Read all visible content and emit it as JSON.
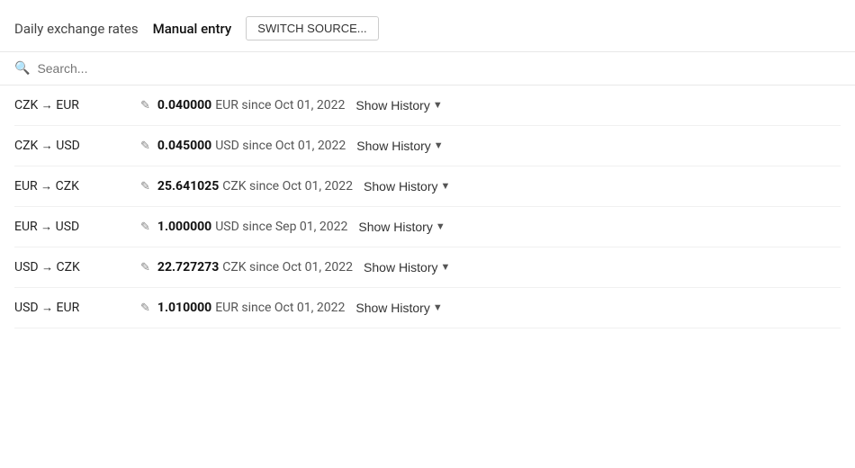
{
  "header": {
    "title": "Daily exchange rates",
    "tab_active": "Manual entry",
    "switch_btn": "SWITCH SOURCE..."
  },
  "search": {
    "placeholder": "Search..."
  },
  "rates": [
    {
      "pair_from": "CZK",
      "pair_to": "EUR",
      "value": "0.040000",
      "currency": "EUR",
      "since": "since Oct 01, 2022",
      "show_history": "Show History"
    },
    {
      "pair_from": "CZK",
      "pair_to": "USD",
      "value": "0.045000",
      "currency": "USD",
      "since": "since Oct 01, 2022",
      "show_history": "Show History"
    },
    {
      "pair_from": "EUR",
      "pair_to": "CZK",
      "value": "25.641025",
      "currency": "CZK",
      "since": "since Oct 01, 2022",
      "show_history": "Show History"
    },
    {
      "pair_from": "EUR",
      "pair_to": "USD",
      "value": "1.000000",
      "currency": "USD",
      "since": "since Sep 01, 2022",
      "show_history": "Show History"
    },
    {
      "pair_from": "USD",
      "pair_to": "CZK",
      "value": "22.727273",
      "currency": "CZK",
      "since": "since Oct 01, 2022",
      "show_history": "Show History"
    },
    {
      "pair_from": "USD",
      "pair_to": "EUR",
      "value": "1.010000",
      "currency": "EUR",
      "since": "since Oct 01, 2022",
      "show_history": "Show History"
    }
  ]
}
